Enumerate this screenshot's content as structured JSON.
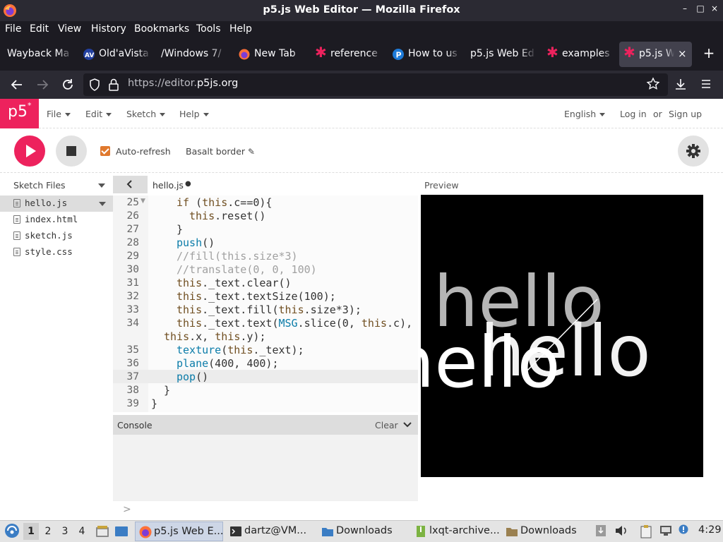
{
  "window": {
    "title": "p5.js Web Editor — Mozilla Firefox",
    "controls": [
      "–",
      "□",
      "×"
    ]
  },
  "menubar": [
    "File",
    "Edit",
    "View",
    "History",
    "Bookmarks",
    "Tools",
    "Help"
  ],
  "tabs": [
    {
      "label": "Wayback Ma",
      "icon": "none"
    },
    {
      "label": "Old'aVista",
      "icon": "altavista-icon"
    },
    {
      "label": "/Windows 7/",
      "icon": "none"
    },
    {
      "label": "New Tab",
      "icon": "firefox-icon"
    },
    {
      "label": "reference",
      "icon": "p5-asterisk-icon"
    },
    {
      "label": "How to us",
      "icon": "p-icon"
    },
    {
      "label": "p5.js Web Ed",
      "icon": "none"
    },
    {
      "label": "examples",
      "icon": "p5-asterisk-icon"
    },
    {
      "label": "p5.js W",
      "icon": "p5-asterisk-icon",
      "active": true
    }
  ],
  "nav": {
    "url_prefix": "https://editor.",
    "url_domain": "p5js.org"
  },
  "p5": {
    "logo": "p5",
    "logo_mark": "*",
    "menu": [
      "File",
      "Edit",
      "Sketch",
      "Help"
    ],
    "language": "English",
    "login": "Log in",
    "or": "or",
    "signup": "Sign up",
    "auto_refresh": "Auto-refresh",
    "sketch_name": "Basalt border",
    "sketch_files": "Sketch Files",
    "files": [
      "hello.js",
      "index.html",
      "sketch.js",
      "style.css"
    ],
    "active_file": "hello.js",
    "preview_label": "Preview",
    "console_label": "Console",
    "clear_label": "Clear",
    "console_prompt": ">"
  },
  "editor": {
    "line_numbers": [
      "25",
      "26",
      "27",
      "28",
      "29",
      "30",
      "31",
      "32",
      "33",
      "34",
      "35",
      "36",
      "37",
      "38",
      "39"
    ],
    "highlighted_line": "37"
  },
  "preview": {
    "texts": [
      "hello",
      "hello",
      "hello"
    ],
    "colors": {
      "grey": "#b5b5b5",
      "white": "#ffffff",
      "light": "#f2f2f2"
    }
  },
  "taskbar": {
    "workspaces": [
      "1",
      "2",
      "3",
      "4"
    ],
    "tasks": [
      {
        "label": "p5.js Web E...",
        "icon": "firefox-icon",
        "active": true
      },
      {
        "label": "dartz@VM...",
        "icon": "terminal-icon"
      },
      {
        "label": "Downloads",
        "icon": "folder-icon"
      },
      {
        "label": "lxqt-archive...",
        "icon": "archive-icon"
      },
      {
        "label": "Downloads",
        "icon": "folder-icon"
      }
    ],
    "clock": "4:29"
  },
  "colors": {
    "accent": "#ed225d",
    "checkbox": "#e0792e",
    "browser_dark": "#1c1b22"
  }
}
